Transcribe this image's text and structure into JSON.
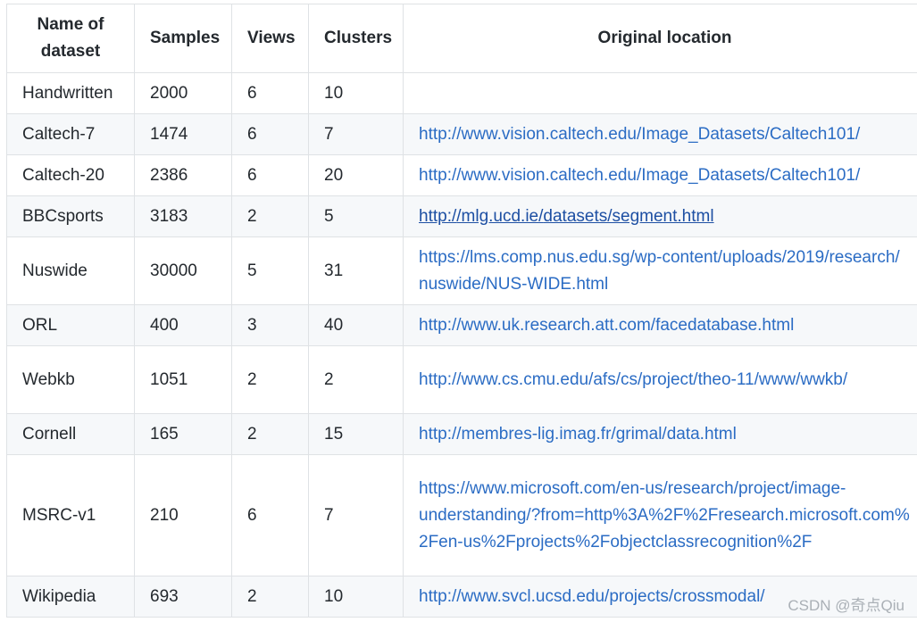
{
  "headers": [
    "Name of dataset",
    "Samples",
    "Views",
    "Clusters",
    "Original location"
  ],
  "rows": [
    {
      "name": "Handwritten",
      "samples": "2000",
      "views": "6",
      "clusters": "10",
      "location": ""
    },
    {
      "name": "Caltech-7",
      "samples": "1474",
      "views": "6",
      "clusters": "7",
      "location": "http://www.vision.caltech.edu/Image_Datasets/Caltech101/"
    },
    {
      "name": "Caltech-20",
      "samples": "2386",
      "views": "6",
      "clusters": "20",
      "location": "http://www.vision.caltech.edu/Image_Datasets/Caltech101/"
    },
    {
      "name": "BBCsports",
      "samples": "3183",
      "views": "2",
      "clusters": "5",
      "location": "http://mlg.ucd.ie/datasets/segment.html"
    },
    {
      "name": "Nuswide",
      "samples": "30000",
      "views": "5",
      "clusters": "31",
      "location": "https://lms.comp.nus.edu.sg/wp-content/uploads/2019/research/nuswide/NUS-WIDE.html"
    },
    {
      "name": "ORL",
      "samples": "400",
      "views": "3",
      "clusters": "40",
      "location": "http://www.uk.research.att.com/facedatabase.html"
    },
    {
      "name": "Webkb",
      "samples": "1051",
      "views": "2",
      "clusters": "2",
      "location": "http://www.cs.cmu.edu/afs/cs/project/theo-11/www/wwkb/"
    },
    {
      "name": "Cornell",
      "samples": "165",
      "views": "2",
      "clusters": "15",
      "location": "http://membres-lig.imag.fr/grimal/data.html"
    },
    {
      "name": "MSRC-v1",
      "samples": "210",
      "views": "6",
      "clusters": "7",
      "location": "https://www.microsoft.com/en-us/research/project/image-understanding/?from=http%3A%2F%2Fresearch.microsoft.com%2Fen-us%2Fprojects%2Fobjectclassrecognition%2F"
    },
    {
      "name": "Wikipedia",
      "samples": "693",
      "views": "2",
      "clusters": "10",
      "location": "http://www.svcl.ucsd.edu/projects/crossmodal/"
    }
  ],
  "link_color": "#2b6cc4",
  "watermark": "CSDN @奇点Qiu"
}
